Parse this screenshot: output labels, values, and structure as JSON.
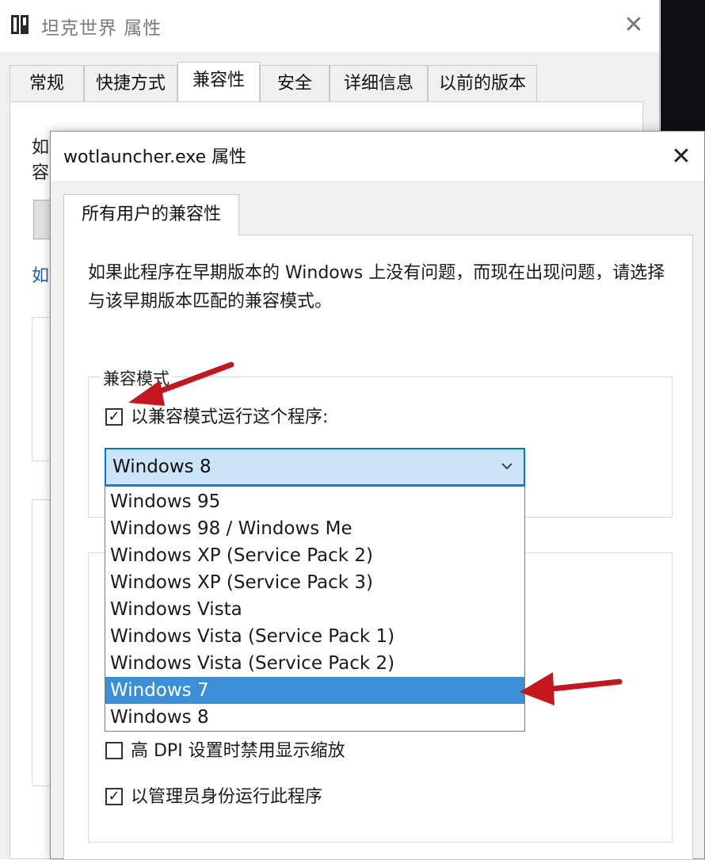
{
  "back_window": {
    "title": "坦克世界 属性",
    "tabs": [
      {
        "label": "常规",
        "active": false
      },
      {
        "label": "快捷方式",
        "active": false
      },
      {
        "label": "兼容性",
        "active": true
      },
      {
        "label": "安全",
        "active": false
      },
      {
        "label": "详细信息",
        "active": false
      },
      {
        "label": "以前的版本",
        "active": false
      }
    ],
    "fragments": {
      "line1": "如",
      "line2": "容",
      "link": "如"
    }
  },
  "dialog": {
    "title": "wotlauncher.exe 属性",
    "tab": "所有用户的兼容性",
    "description": "如果此程序在早期版本的 Windows 上没有问题，而现在出现问题，请选择与该早期版本匹配的兼容模式。",
    "compat_group": {
      "label": "兼容模式",
      "checkbox_label": "以兼容模式运行这个程序:",
      "checked": true
    },
    "combo": {
      "value": "Windows 8",
      "options": [
        "Windows 95",
        "Windows 98 / Windows Me",
        "Windows XP (Service Pack 2)",
        "Windows XP (Service Pack 3)",
        "Windows Vista",
        "Windows Vista (Service Pack 1)",
        "Windows Vista (Service Pack 2)",
        "Windows 7",
        "Windows 8"
      ],
      "highlighted": "Windows 7"
    },
    "settings": {
      "dpi_label": "高 DPI 设置时禁用显示缩放",
      "dpi_checked": false,
      "admin_label": "以管理员身份运行此程序",
      "admin_checked": true
    }
  },
  "colors": {
    "selection": "#3b8fd6",
    "combo_bg": "#cce4f7",
    "arrow": "#c4161c"
  }
}
